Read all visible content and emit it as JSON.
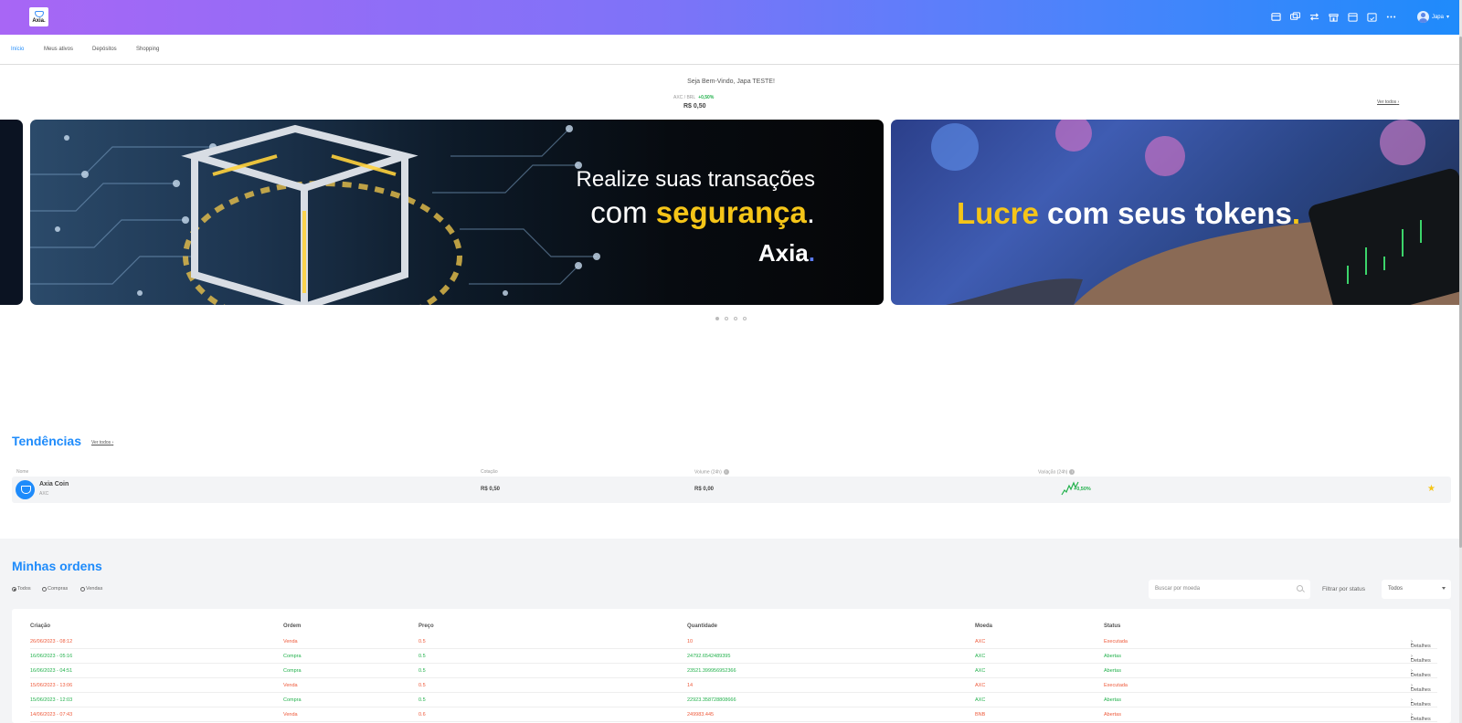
{
  "brand": {
    "logo_text": "Axia."
  },
  "topbar": {
    "icons": [
      "wallet-icon",
      "cards-icon",
      "transfer-icon",
      "store-icon",
      "calendar-icon",
      "calendar-check-icon",
      "more-icon"
    ],
    "user_name": "Japa"
  },
  "nav": {
    "tabs": [
      "Início",
      "Meus ativos",
      "Depósitos",
      "Shopping"
    ],
    "active": "Início"
  },
  "welcome": "Seja Bem-Vindo, Japa TESTE!",
  "ticker": {
    "pair": "AXC / BRL",
    "change": "+0,50%",
    "price": "R$ 0,50",
    "see_all": "Ver todos"
  },
  "banners": [
    {
      "line1": "Realize suas transações",
      "line2_prefix": "com ",
      "line2_highlight": "segurança",
      "line2_suffix": ".",
      "brand": "Axia",
      "brand_dot": "."
    },
    {
      "highlight": "Lucre",
      "text": " com seus tokens",
      "dot": "."
    }
  ],
  "carousel": {
    "count": 4,
    "active": 0
  },
  "trends": {
    "title": "Tendências",
    "see_all": "Ver todos",
    "columns": [
      "Nome",
      "Cotação",
      "Volume (24h)",
      "Variação (24h)"
    ],
    "rows": [
      {
        "name": "Axia Coin",
        "symbol": "AXC",
        "price": "R$ 0,50",
        "volume": "R$ 0,00",
        "change": "+0,50%"
      }
    ]
  },
  "orders": {
    "title": "Minhas ordens",
    "filters": [
      "Todos",
      "Compras",
      "Vendas"
    ],
    "selected_filter": "Todos",
    "search_placeholder": "Buscar por moeda",
    "status_label": "Filtrar por status",
    "status_value": "Todos",
    "columns": [
      "Criação",
      "Ordem",
      "Preço",
      "Quantidade",
      "Moeda",
      "Status"
    ],
    "details_label": "Detalhes",
    "rows": [
      {
        "date": "26/06/2023 - 08:12",
        "type": "Venda",
        "price": "0.5",
        "qty": "10",
        "coin": "AXC",
        "status": "Executada"
      },
      {
        "date": "16/06/2023 - 05:16",
        "type": "Compra",
        "price": "0.5",
        "qty": "24792.6542489395",
        "coin": "AXC",
        "status": "Abertas"
      },
      {
        "date": "16/06/2023 - 04:51",
        "type": "Compra",
        "price": "0.5",
        "qty": "23521.399956952366",
        "coin": "AXC",
        "status": "Abertas"
      },
      {
        "date": "15/06/2023 - 13:06",
        "type": "Venda",
        "price": "0.5",
        "qty": "14",
        "coin": "AXC",
        "status": "Executada"
      },
      {
        "date": "15/06/2023 - 12:03",
        "type": "Compra",
        "price": "0.5",
        "qty": "22923.358728808666",
        "coin": "AXC",
        "status": "Abertas"
      },
      {
        "date": "14/06/2023 - 07:43",
        "type": "Venda",
        "price": "0.6",
        "qty": "249983.445",
        "coin": "BNB",
        "status": "Abertas"
      }
    ]
  },
  "colors": {
    "accent": "#1e8bfb",
    "buy": "#22b14c",
    "sell": "#ee5a3b",
    "highlight": "#f5c518",
    "gradient_start": "#a866f5",
    "gradient_end": "#1e8bfb"
  }
}
